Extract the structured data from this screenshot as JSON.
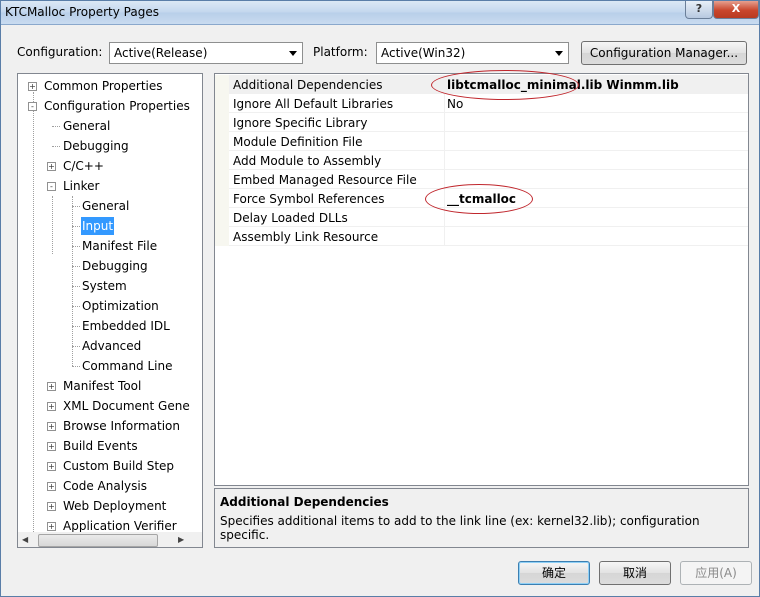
{
  "window": {
    "title": "KTCMalloc Property Pages",
    "help_label": "?",
    "close_label": "X"
  },
  "toolbar": {
    "configuration_label": "Configuration:",
    "configuration_value": "Active(Release)",
    "platform_label": "Platform:",
    "platform_value": "Active(Win32)",
    "config_manager_label": "Configuration Manager..."
  },
  "tree": {
    "items": [
      {
        "label": "Common Properties",
        "expander": "+"
      },
      {
        "label": "Configuration Properties",
        "expander": "-"
      },
      {
        "label": "General"
      },
      {
        "label": "Debugging"
      },
      {
        "label": "C/C++",
        "expander": "+"
      },
      {
        "label": "Linker",
        "expander": "-"
      },
      {
        "label": "General"
      },
      {
        "label": "Input",
        "selected": true
      },
      {
        "label": "Manifest File"
      },
      {
        "label": "Debugging"
      },
      {
        "label": "System"
      },
      {
        "label": "Optimization"
      },
      {
        "label": "Embedded IDL"
      },
      {
        "label": "Advanced"
      },
      {
        "label": "Command Line"
      },
      {
        "label": "Manifest Tool",
        "expander": "+"
      },
      {
        "label": "XML Document Gene",
        "expander": "+"
      },
      {
        "label": "Browse Information",
        "expander": "+"
      },
      {
        "label": "Build Events",
        "expander": "+"
      },
      {
        "label": "Custom Build Step",
        "expander": "+"
      },
      {
        "label": "Code Analysis",
        "expander": "+"
      },
      {
        "label": "Web Deployment",
        "expander": "+"
      },
      {
        "label": "Application Verifier",
        "expander": "+"
      }
    ]
  },
  "properties": {
    "rows": [
      {
        "name": "Additional Dependencies",
        "value": "libtcmalloc_minimal.lib Winmm.lib",
        "bold": true
      },
      {
        "name": "Ignore All Default Libraries",
        "value": "No",
        "bold": false
      },
      {
        "name": "Ignore Specific Library",
        "value": ""
      },
      {
        "name": "Module Definition File",
        "value": ""
      },
      {
        "name": "Add Module to Assembly",
        "value": ""
      },
      {
        "name": "Embed Managed Resource File",
        "value": ""
      },
      {
        "name": "Force Symbol References",
        "value": "__tcmalloc",
        "bold": true
      },
      {
        "name": "Delay Loaded DLLs",
        "value": ""
      },
      {
        "name": "Assembly Link Resource",
        "value": ""
      }
    ]
  },
  "description": {
    "title": "Additional Dependencies",
    "text": "Specifies additional items to add to the link line (ex: kernel32.lib); configuration specific."
  },
  "buttons": {
    "ok": "确定",
    "cancel": "取消",
    "apply": "应用(A)"
  },
  "colors": {
    "selection": "#3399ff",
    "annotation": "#c0272d"
  }
}
